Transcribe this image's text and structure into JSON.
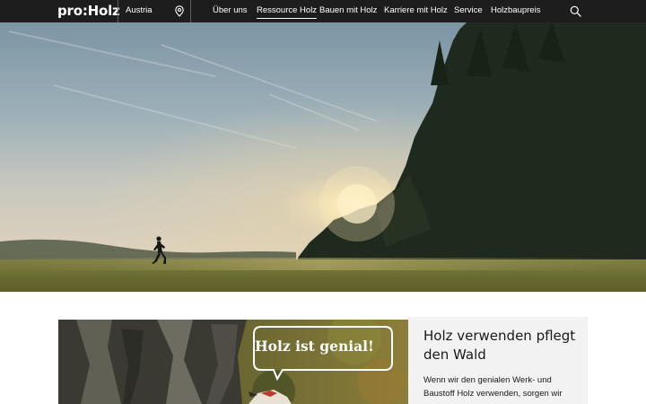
{
  "header": {
    "logo": "pro:Holz",
    "country": "Austria",
    "nav": [
      {
        "label": "Über uns",
        "active": false
      },
      {
        "label": "Ressource Holz",
        "active": true
      },
      {
        "label": "Bauen mit Holz",
        "active": false
      },
      {
        "label": "Karriere mit Holz",
        "active": false
      },
      {
        "label": "Service",
        "active": false
      },
      {
        "label": "Holzbaupreis",
        "active": false
      }
    ],
    "icons": {
      "location": "location-pin-icon",
      "search": "search-icon"
    }
  },
  "teaser": {
    "image_caption": "Holz ist genial!",
    "title": "Holz verwenden pflegt den Wald",
    "text": "Wenn wir den genialen Werk- und Baustoff Holz verwenden, sorgen wir"
  },
  "colors": {
    "header_bg": "#1d1d1d",
    "card_bg": "#f2f2f2",
    "text": "#1a1a1a"
  }
}
